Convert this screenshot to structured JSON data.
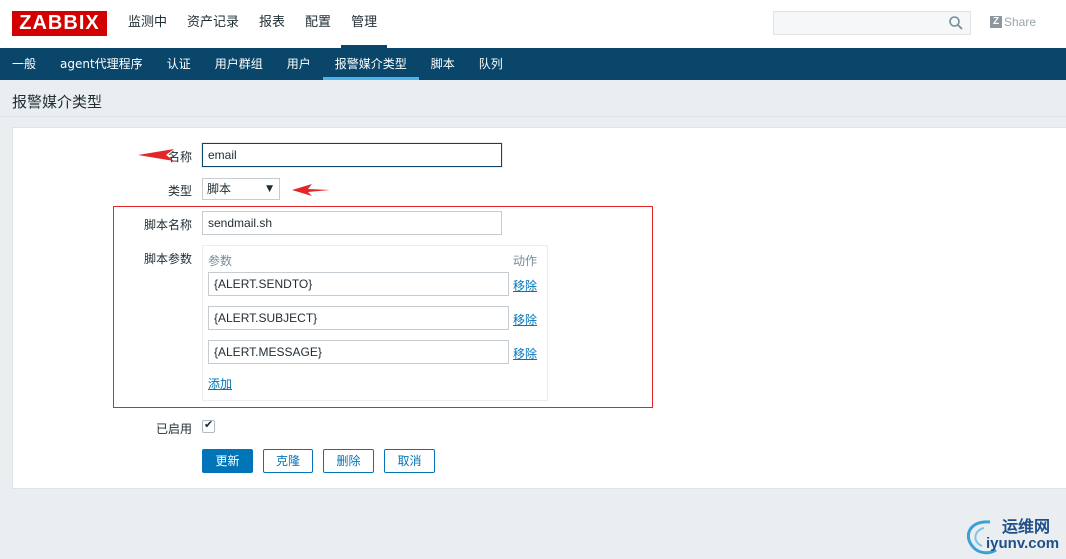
{
  "header": {
    "logo": "ZABBIX",
    "nav": [
      "监测中",
      "资产记录",
      "报表",
      "配置",
      "管理"
    ],
    "active_nav": 4,
    "search_value": "",
    "share_label": "Share",
    "share_icon_letter": "Z"
  },
  "subnav": {
    "items": [
      "一般",
      "agent代理程序",
      "认证",
      "用户群组",
      "用户",
      "报警媒介类型",
      "脚本",
      "队列"
    ],
    "active": 5
  },
  "page_title": "报警媒介类型",
  "form": {
    "name_label": "名称",
    "name_value": "email",
    "type_label": "类型",
    "type_value": "脚本",
    "script_name_label": "脚本名称",
    "script_name_value": "sendmail.sh",
    "script_params_label": "脚本参数",
    "params_header": "参数",
    "actions_header": "动作",
    "params": [
      {
        "value": "{ALERT.SENDTO}",
        "remove_label": "移除"
      },
      {
        "value": "{ALERT.SUBJECT}",
        "remove_label": "移除"
      },
      {
        "value": "{ALERT.MESSAGE}",
        "remove_label": "移除"
      }
    ],
    "add_label": "添加",
    "enabled_label": "已启用",
    "enabled": true
  },
  "buttons": {
    "update": "更新",
    "clone": "克隆",
    "delete": "删除",
    "cancel": "取消"
  },
  "watermark": {
    "line1": "运维网",
    "line2": "iyunv.com"
  },
  "colors": {
    "brand_red": "#d40000",
    "nav_dark": "#0a466a",
    "link_blue": "#0275b8",
    "annotation_red": "#e4252a"
  }
}
